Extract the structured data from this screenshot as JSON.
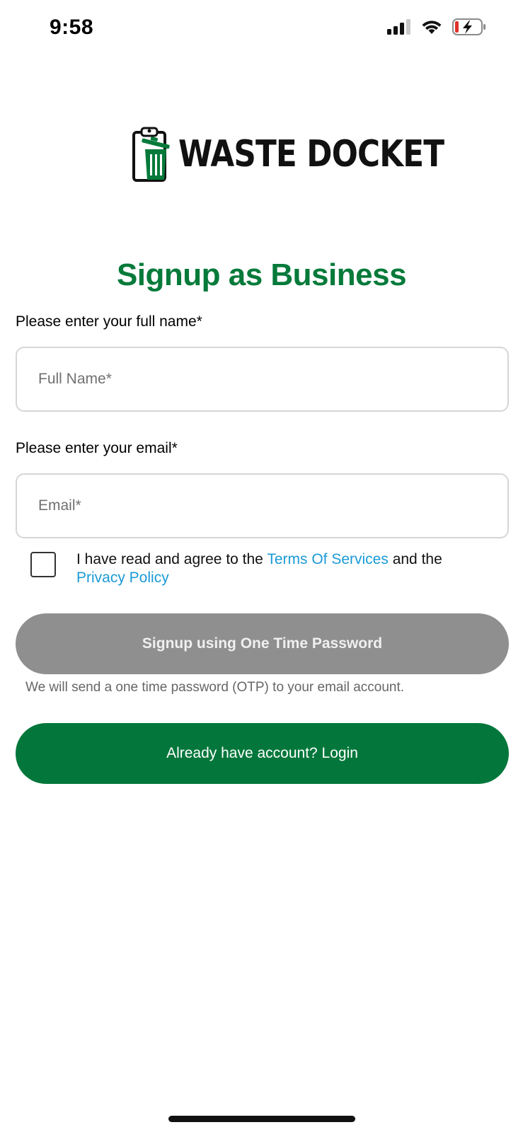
{
  "status_bar": {
    "time": "9:58",
    "icons": [
      "cellular-signal-icon",
      "wifi-icon",
      "battery-charging-icon"
    ]
  },
  "logo": {
    "text": "WASTE DOCKET",
    "icon": "clipboard-trash-icon",
    "colors": {
      "green": "#067a3a",
      "black": "#111111"
    }
  },
  "title": "Signup as Business",
  "form": {
    "name_label": "Please enter your full name*",
    "name_placeholder": "Full Name*",
    "name_value": "",
    "email_label": "Please enter your email*",
    "email_placeholder": "Email*",
    "email_value": "",
    "agree": {
      "checked": false,
      "text_before": "I have read and agree to the ",
      "terms_link": "Terms Of Services",
      "text_middle": " and the",
      "privacy_link": "Privacy Policy"
    },
    "otp_button_label": "Signup using One Time Password",
    "otp_hint": "We will send a one time password (OTP) to your email account.",
    "login_button_label": "Already have account? Login"
  },
  "colors": {
    "accent_green": "#067a3a",
    "login_button": "#03773b",
    "disabled_button": "#8f8f8f",
    "link_blue": "#1a9ad6"
  }
}
